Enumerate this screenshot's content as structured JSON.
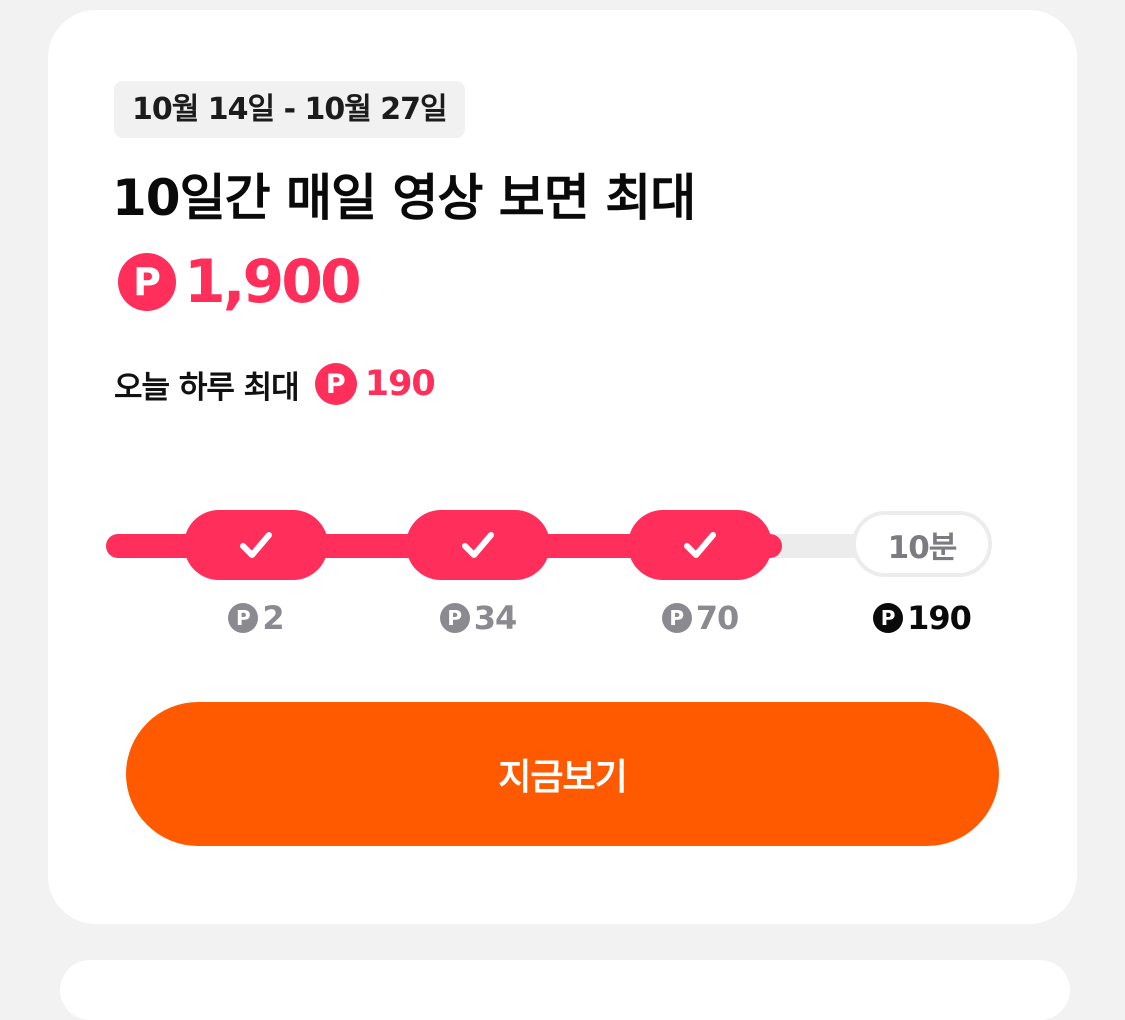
{
  "promo": {
    "date_range": "10월 14일 - 10월 27일",
    "headline": "10일간 매일 영상 보면 최대",
    "max_amount": "1,900",
    "today_label": "오늘 하루 최대",
    "today_amount": "190",
    "point_symbol": "P",
    "accent_color": "#ff2e5a",
    "cta_color": "#ff5a00"
  },
  "progress": {
    "steps": [
      {
        "reward": "2",
        "completed": true
      },
      {
        "reward": "34",
        "completed": true
      },
      {
        "reward": "70",
        "completed": true
      },
      {
        "reward": "190",
        "completed": false,
        "label": "10분"
      }
    ]
  },
  "cta": {
    "label": "지금보기"
  }
}
